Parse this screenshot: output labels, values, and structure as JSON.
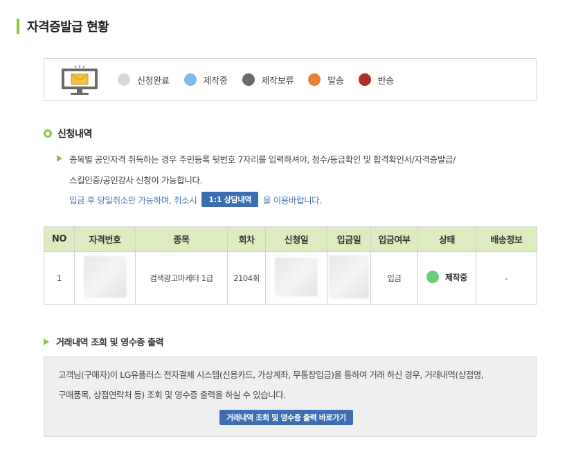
{
  "page": {
    "title": "자격증발급 현황"
  },
  "legend": {
    "icon": "monitor-mail-icon",
    "items": [
      {
        "label": "신청완료",
        "color": "#d9d9d9"
      },
      {
        "label": "제작중",
        "color": "#7fb8ea"
      },
      {
        "label": "제작보류",
        "color": "#6b6b6b"
      },
      {
        "label": "발송",
        "color": "#ea7f38"
      },
      {
        "label": "반송",
        "color": "#b32b2b"
      }
    ]
  },
  "section": {
    "title": "신청내역",
    "notice_line1": "종목별 공인자격 취득하는 경우 주민등록 뒷번호 7자리를 입력하셔야, 점수/등급확인 및 합격확인서/자격증발급/",
    "notice_line2": "스킬인증/공인강사 신청이 가능합니다.",
    "notice_line3_before": "입금 후 당일취소만 가능하며, 취소시",
    "consult_button": "1:1 상담내역",
    "notice_line3_after": "을 이용바랍니다."
  },
  "table": {
    "headers": [
      "NO",
      "자격번호",
      "종목",
      "회차",
      "신청일",
      "입금일",
      "입금여부",
      "상태",
      "배송정보"
    ],
    "rows": [
      {
        "no": "1",
        "cert_no": "",
        "subject": "검색광고마케터 1급",
        "round": "2104회",
        "apply_date": "",
        "deposit_date": "",
        "deposit_status": "입금",
        "status": "제작중",
        "status_color": "#6dcb7c",
        "delivery": "-"
      }
    ]
  },
  "receipt": {
    "title": "거래내역 조회 및 영수증 출력",
    "text_line1": "고객님(구매자)이 LG유플러스 전자결제 시스템(신용카드, 가상계좌, 무통장입금)을 통하여 거래 하신 경우, 거래내역(상점명,",
    "text_line2": "구매품목, 상점연락처 등) 조회 및 영수증 출력을 하실 수 있습니다.",
    "button": "거래내역 조회 및 영수증 출력 바로가기"
  }
}
